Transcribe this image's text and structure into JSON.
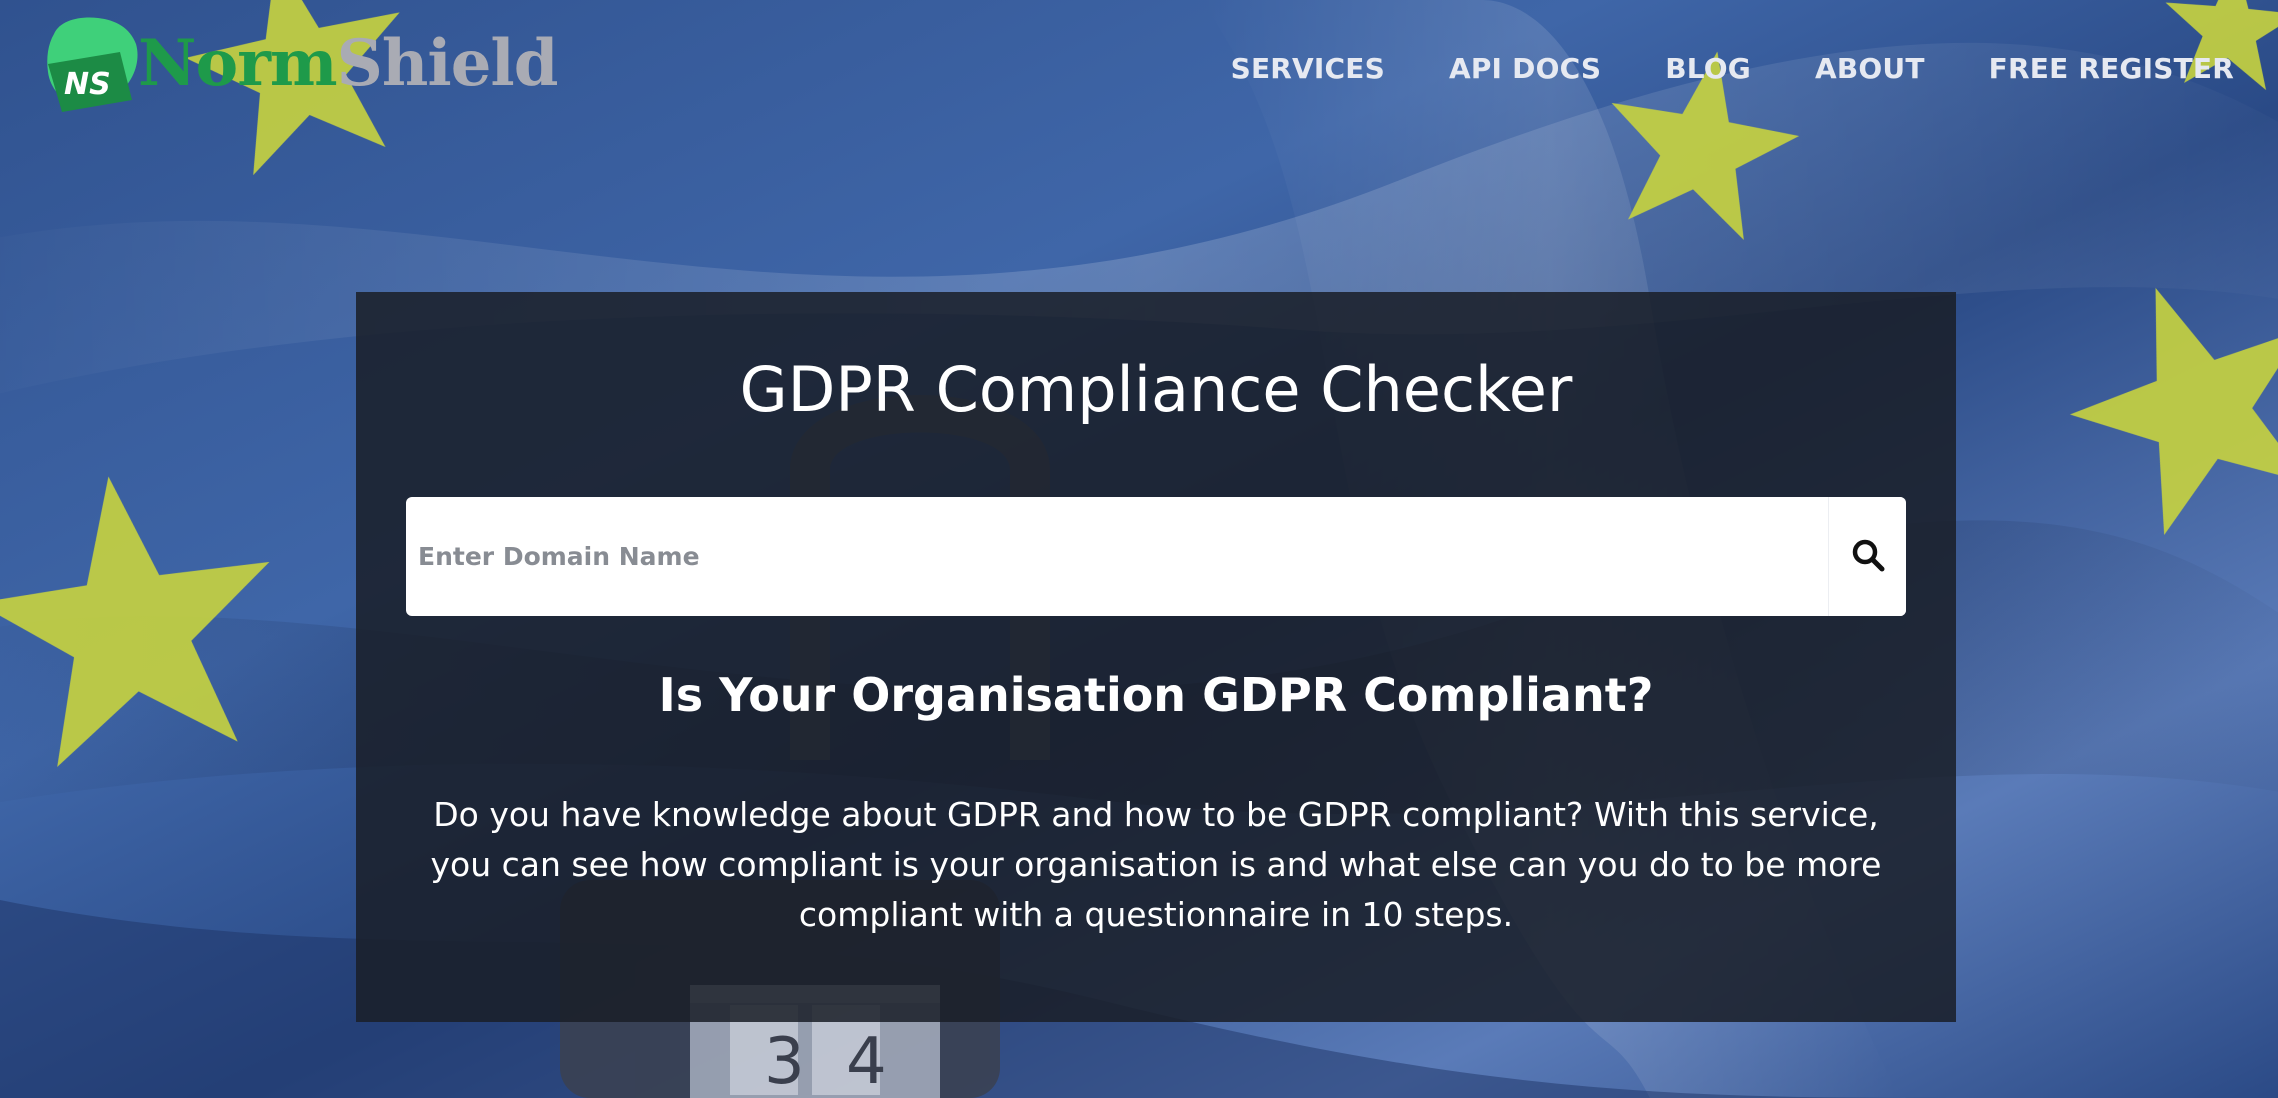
{
  "brand": {
    "logo_initials": "NS",
    "name_part1": "Norm",
    "name_part2": "Shield",
    "colors": {
      "green": "#1e9a4a",
      "light_green": "#3fd07a",
      "gray": "#a9abb4"
    }
  },
  "nav": {
    "items": [
      {
        "label": "SERVICES"
      },
      {
        "label": "API DOCS"
      },
      {
        "label": "BLOG"
      },
      {
        "label": "ABOUT"
      },
      {
        "label": "FREE REGISTER"
      }
    ]
  },
  "hero": {
    "title": "GDPR Compliance Checker",
    "search": {
      "placeholder": "Enter Domain Name",
      "value": "",
      "icon": "search-icon"
    },
    "subtitle": "Is Your Organisation GDPR Compliant?",
    "description": "Do you have knowledge about GDPR and how to be GDPR compliant? With this service, you can see how compliant is your organisation is and what else can you do to be more compliant with a questionnaire in 10 steps."
  },
  "background": {
    "description_icon": "eu-flag-background",
    "padlock_digits": "34",
    "flag_blue": "#2a4c8f",
    "star_yellow": "#c9d43f"
  }
}
